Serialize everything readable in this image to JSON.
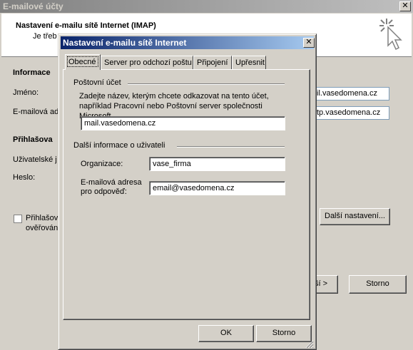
{
  "background_window": {
    "title": "E-mailové účty",
    "header_title": "Nastavení e-mailu sítě Internet (IMAP)",
    "header_subtitle": "Je třeb",
    "section_info": "Informace",
    "label_name": "Jméno:",
    "label_email": "E-mailová ad",
    "input_incoming_value": "il.vasedomena.cz",
    "input_outgoing_value": "tp.vasedomena.cz",
    "section_login": "Přihlašova",
    "label_username": "Uživatelské j",
    "label_password": "Heslo:",
    "checkbox_line1": "Přihlašov",
    "checkbox_line2": "ověřován",
    "more_settings_button": "Další nastavení...",
    "next_button": "ší >",
    "cancel_button": "Storno"
  },
  "dialog": {
    "title": "Nastavení e-mailu sítě Internet",
    "close_label": "✕",
    "tabs": [
      {
        "label": "Obecné",
        "active": true
      },
      {
        "label": "Server pro odchozí poštu",
        "active": false
      },
      {
        "label": "Připojení",
        "active": false
      },
      {
        "label": "Upřesnit",
        "active": false
      }
    ],
    "mail_account": {
      "group_label": "Poštovní účet",
      "description": "Zadejte název, kterým chcete odkazovat na tento účet, například Pracovní nebo Poštovní server společnosti Microsoft.",
      "account_name_value": "mail.vasedomena.cz"
    },
    "user_info": {
      "group_label": "Další informace o uživateli",
      "organization_label": "Organizace:",
      "organization_value": "vase_firma",
      "reply_label_line1": "E-mailová adresa",
      "reply_label_line2": "pro odpověď:",
      "reply_value": "email@vasedomena.cz"
    },
    "ok_button": "OK",
    "cancel_button": "Storno"
  }
}
